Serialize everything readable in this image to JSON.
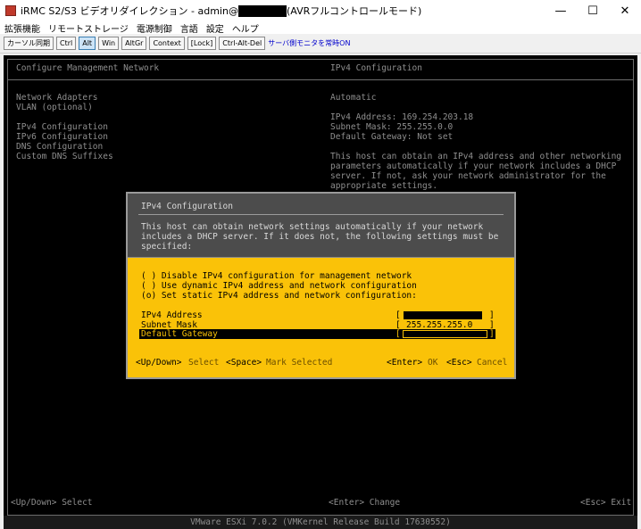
{
  "window": {
    "title_prefix": "iRMC S2/S3 ビデオリダイレクション - admin@",
    "title_suffix": "(AVRフルコントロールモード)",
    "buttons": {
      "minimize": "—",
      "maximize": "☐",
      "close": "✕"
    }
  },
  "menubar": [
    "拡張機能",
    "リモートストレージ",
    "電源制御",
    "言語",
    "設定",
    "ヘルプ"
  ],
  "toolbar": {
    "buttons": [
      "カーソル同期",
      "Ctrl",
      "Alt",
      "Win",
      "AltGr",
      "Context",
      "[Lock]",
      "Ctrl-Alt-Del"
    ],
    "link": "サーバ側モニタを常時ON"
  },
  "console": {
    "left_title": "Configure Management Network",
    "right_title": "IPv4 Configuration",
    "menu_items": [
      "Network Adapters",
      "VLAN (optional)",
      "IPv4 Configuration",
      "IPv6 Configuration",
      "DNS Configuration",
      "Custom DNS Suffixes"
    ],
    "right_mode": "Automatic",
    "ipv4_address": "IPv4 Address: 169.254.203.18",
    "subnet_mask": "Subnet Mask: 255.255.0.0",
    "default_gateway": "Default Gateway: Not set",
    "description": [
      "This host can obtain an IPv4 address and other networking",
      "parameters automatically if your network includes a DHCP",
      "server. If not, ask your network administrator for the",
      "appropriate settings."
    ],
    "footer_left": "<Up/Down> Select",
    "footer_mid": "<Enter> Change",
    "footer_right": "<Esc> Exit",
    "status_bar": "VMware ESXi 7.0.2 (VMKernel Release Build 17630552)"
  },
  "dialog": {
    "title": "IPv4 Configuration",
    "intro": [
      "This host can obtain network settings automatically if your network",
      "includes a DHCP server. If it does not, the following settings must be",
      "specified:"
    ],
    "options": [
      "( ) Disable IPv4 configuration for management network",
      "( ) Use dynamic IPv4 address and network configuration",
      "(o) Set static IPv4 address and network configuration:"
    ],
    "fields": {
      "ipv4_label": "IPv4 Address",
      "subnet_label": "Subnet Mask",
      "subnet_value": "255.255.255.0",
      "gateway_label": "Default Gateway"
    },
    "footer": {
      "updown_key": "<Up/Down>",
      "updown_text": "Select",
      "space_key": "<Space>",
      "space_text": "Mark Selected",
      "enter_key": "<Enter>",
      "enter_text": "OK",
      "esc_key": "<Esc>",
      "esc_text": "Cancel"
    }
  },
  "colors": {
    "dialog_bg": "#fac208",
    "dialog_header": "#4c4c4c",
    "console_bg": "#000000"
  }
}
